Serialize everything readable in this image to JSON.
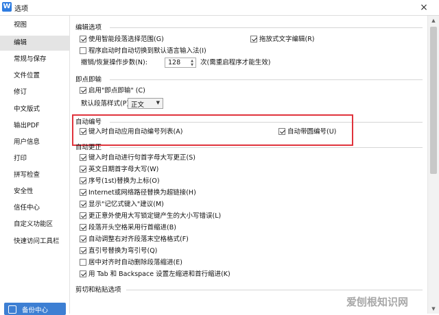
{
  "window": {
    "title": "选项",
    "icon_letter": "W",
    "close": "×"
  },
  "nav": {
    "items": [
      "视图",
      "编辑",
      "常规与保存",
      "文件位置",
      "修订",
      "中文版式",
      "输出PDF",
      "用户信息",
      "打印",
      "拼写检查",
      "安全性",
      "信任中心",
      "自定义功能区",
      "快速访问工具栏"
    ],
    "active": "编辑",
    "bottom_label": "备份中心"
  },
  "edit_options": {
    "title": "编辑选项",
    "smart_select": "使用智能段落选择范围(G)",
    "drag_drop": "拖放式文字编辑(R)",
    "auto_ime": "程序启动时自动切换到默认语言输入法(I)",
    "undo_label": "撤销/恢复操作步数(N):",
    "undo_value": "128",
    "undo_suffix": "次(需重启程序才能生效)"
  },
  "click_type": {
    "title": "即点即输",
    "enable": "启用\"即点即输\" (C)",
    "style_label": "默认段落样式(P):",
    "style_value": "正文"
  },
  "auto_numbering": {
    "title": "自动编号",
    "auto_list": "键入时自动应用自动编号列表(A)",
    "auto_circle": "自动带圆编号(U)"
  },
  "auto_correct": {
    "title": "自动更正",
    "items": [
      "键入时自动进行句首字母大写更正(S)",
      "英文日期首字母大写(W)",
      "序号(1st)替换为上标(O)",
      "Internet或网络路径替换为超链接(H)",
      "显示\"记忆式键入\"建议(M)",
      "更正意外使用大写锁定键产生的大小写错误(L)",
      "段落开头空格采用行首缩进(B)",
      "自动调整右对齐段落末空格格式(F)",
      "直引号替换为弯引号(Q)",
      "居中对齐时自动删除段落缩进(E)",
      "用 Tab 和 Backspace 设置左缩进和首行缩进(K)"
    ]
  },
  "cut_paste": {
    "title": "剪切和粘贴选项"
  },
  "watermark": "爱刨根知识网"
}
